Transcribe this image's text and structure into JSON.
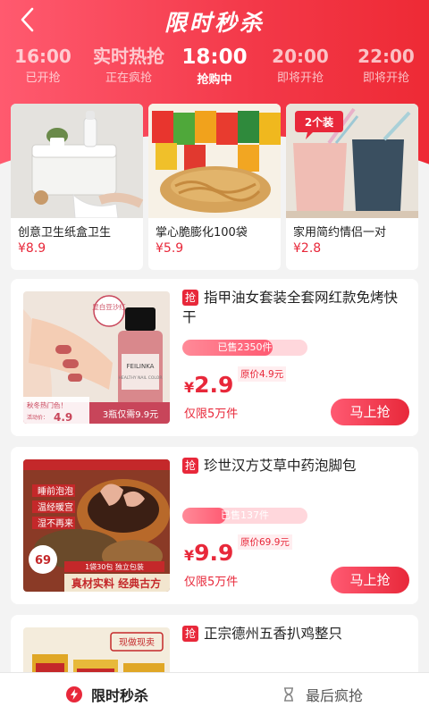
{
  "header": {
    "title": "限时秒杀"
  },
  "time_tabs": [
    {
      "time": "16:00",
      "status": "已开抢"
    },
    {
      "time": "实时热抢",
      "status": "正在疯抢"
    },
    {
      "time": "18:00",
      "status": "抢购中"
    },
    {
      "time": "20:00",
      "status": "即将开抢"
    },
    {
      "time": "22:00",
      "status": "即将开抢"
    }
  ],
  "top_products": [
    {
      "name": "创意卫生纸盒卫生",
      "price": "¥8.9",
      "img_text": ""
    },
    {
      "name": "掌心脆膨化100袋",
      "price": "¥5.9",
      "img_text": ""
    },
    {
      "name": "家用简约情侣一对",
      "price": "¥2.8",
      "img_text": "2个装"
    }
  ],
  "products": [
    {
      "badge": "抢",
      "title": "指甲油女套装全套网红款免烤快干",
      "sold": "已售2350件",
      "sold_ratio": 0.72,
      "currency": "¥",
      "price": "2.9",
      "original_price": "原价4.9元",
      "limit": "仅限5万件",
      "buy_label": "马上抢",
      "img_tags": {
        "corner": "显白豆沙红",
        "promo1": "秋冬热门色！",
        "promo2": "活动价：",
        "promo_price": "4.9",
        "promo3": "3瓶仅需9.9元",
        "brand": "FEILINKA",
        "bottle_sub": "HEALTHY NAIL COLOR"
      }
    },
    {
      "badge": "抢",
      "title": "珍世汉方艾草中药泡脚包",
      "sold": "已售137件",
      "sold_ratio": 0.35,
      "currency": "¥",
      "price": "9.9",
      "original_price": "原价69.9元",
      "limit": "仅限5万件",
      "buy_label": "马上抢",
      "img_tags": {
        "t1": "睡前泡泡",
        "t2": "温经暖宫",
        "t3": "湿不再来",
        "price_tag": "69",
        "pack": "1袋30包 独立包装",
        "slogan": "真材实料 经典古方"
      }
    },
    {
      "badge": "抢",
      "title": "正宗德州五香扒鸡整只",
      "img_tags": {
        "seal": "现做现卖"
      }
    }
  ],
  "bottom_nav": [
    {
      "label": "限时秒杀",
      "icon": "lightning-icon",
      "active": true
    },
    {
      "label": "最后疯抢",
      "icon": "hourglass-icon",
      "active": false
    }
  ],
  "colors": {
    "accent": "#e8283a",
    "header_gradient_start": "#ff5a6f",
    "header_gradient_end": "#ee2a35"
  }
}
